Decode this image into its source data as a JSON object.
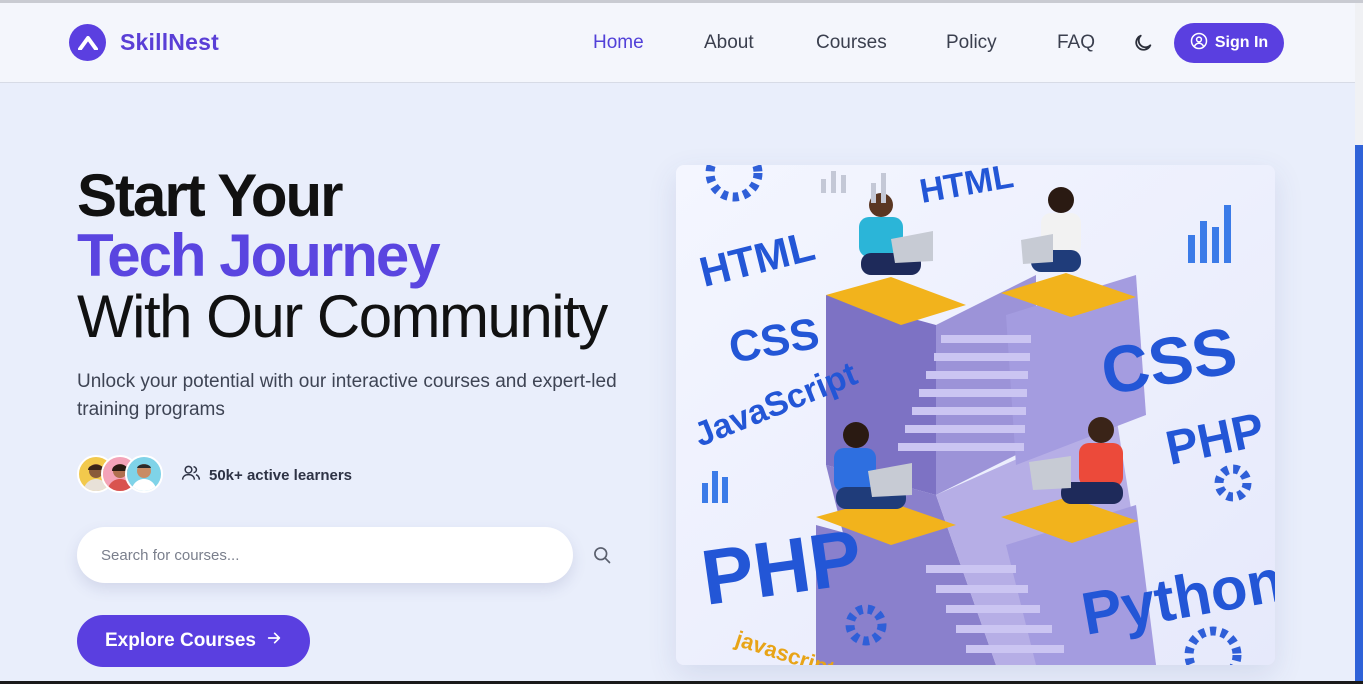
{
  "brand": {
    "name": "SkillNest"
  },
  "nav": {
    "items": [
      {
        "label": "Home",
        "active": true
      },
      {
        "label": "About"
      },
      {
        "label": "Courses"
      },
      {
        "label": "Policy"
      },
      {
        "label": "FAQ"
      }
    ],
    "theme_icon": "moon-icon",
    "signin": {
      "label": "Sign In",
      "icon": "user-circle-icon"
    }
  },
  "hero": {
    "line1": "Start Your",
    "line2": "Tech Journey",
    "line3": "With Our Community",
    "subtitle": "Unlock your potential with our interactive courses and expert-led training programs",
    "learners": {
      "text": "50k+ active learners",
      "icon": "users-icon"
    },
    "search": {
      "placeholder": "Search for courses...",
      "value": ""
    },
    "cta": {
      "label": "Explore Courses",
      "icon": "arrow-right-icon"
    },
    "illustration": {
      "tags": [
        "HTML",
        "HTML",
        "CSS",
        "CSS",
        "JavaScript",
        "PHP",
        "PHP",
        "Python",
        "javascript"
      ]
    }
  },
  "colors": {
    "accent": "#5a3fe0",
    "background": "#e9eefb",
    "nav_bg": "#f4f6fc"
  }
}
